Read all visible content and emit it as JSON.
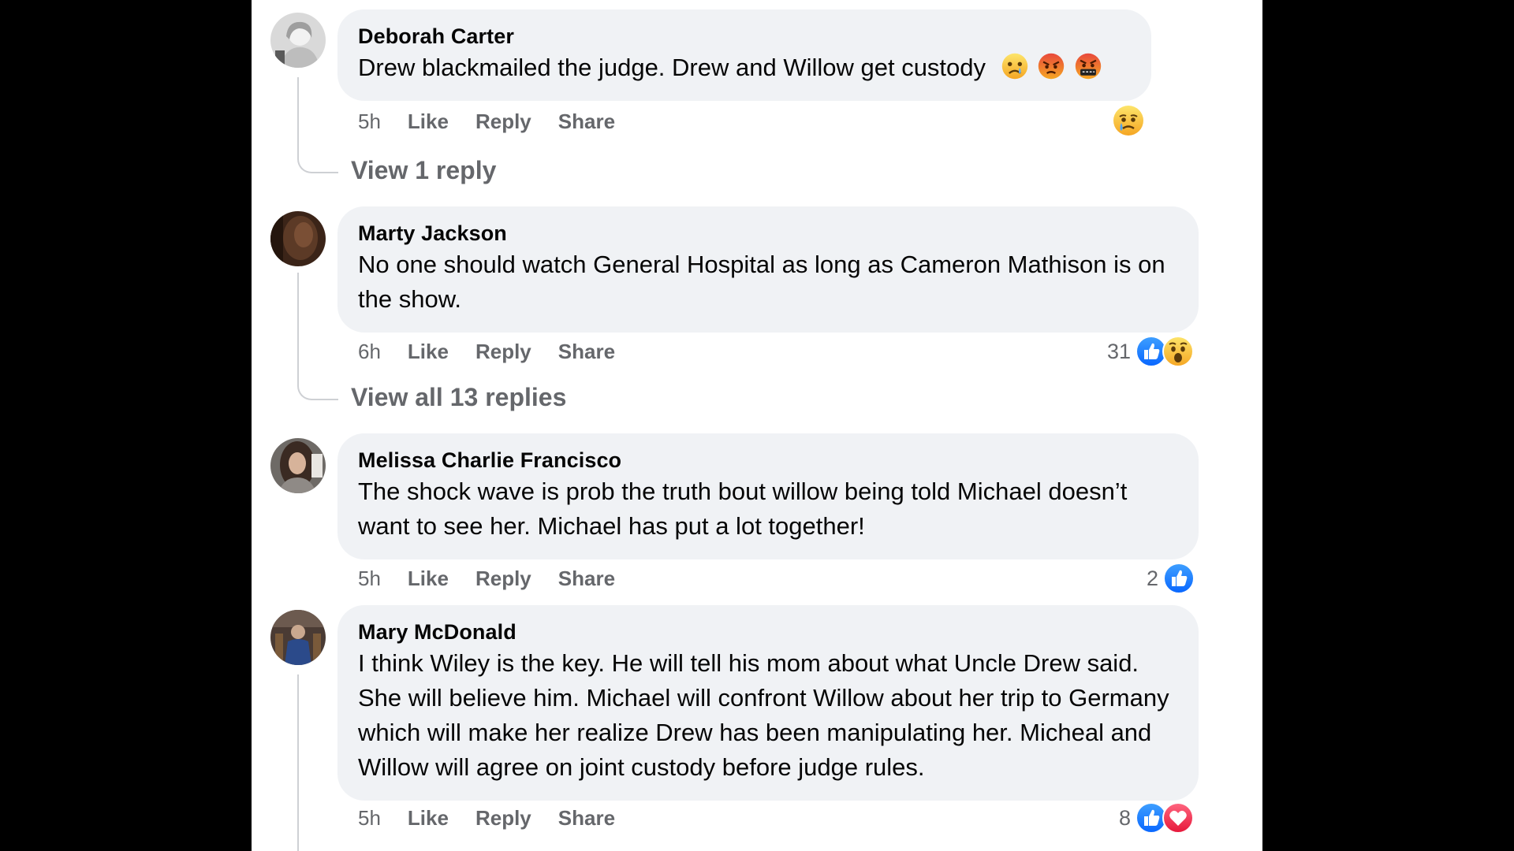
{
  "comments": [
    {
      "author": "Deborah Carter",
      "text": "Drew blackmailed the judge. Drew and Willow get custody",
      "text_emojis": [
        "sad-emoji",
        "angry-emoji",
        "cursing-emoji"
      ],
      "time": "5h",
      "like_label": "Like",
      "reply_label": "Reply",
      "share_label": "Share",
      "reaction_count": "",
      "reactions": [
        "sad-reaction"
      ],
      "view_replies": "View 1 reply"
    },
    {
      "author": "Marty Jackson",
      "text": "No one should watch General Hospital as long as Cameron Mathison is on the show.",
      "time": "6h",
      "like_label": "Like",
      "reply_label": "Reply",
      "share_label": "Share",
      "reaction_count": "31",
      "reactions": [
        "like-reaction",
        "wow-reaction"
      ],
      "view_replies": "View all 13 replies"
    },
    {
      "author": "Melissa Charlie Francisco",
      "text": "The shock wave is prob the truth bout willow being told Michael doesn’t want to see her. Michael has put a lot together!",
      "time": "5h",
      "like_label": "Like",
      "reply_label": "Reply",
      "share_label": "Share",
      "reaction_count": "2",
      "reactions": [
        "like-reaction"
      ]
    },
    {
      "author": "Mary McDonald",
      "text": "I think Wiley is the key. He will tell his mom about what Uncle Drew said. She will believe him. Michael will confront Willow about her trip to Germany which will make her realize Drew has been manipulating her. Micheal and Willow will agree on joint custody before judge rules.",
      "time": "5h",
      "like_label": "Like",
      "reply_label": "Reply",
      "share_label": "Share",
      "reaction_count": "8",
      "reactions": [
        "like-reaction",
        "love-reaction"
      ]
    }
  ],
  "colors": {
    "page_bg": "#000000",
    "panel_bg": "#ffffff",
    "bubble_bg": "#f0f2f5",
    "muted_text": "#65676b",
    "main_text": "#050505",
    "like_blue": "#1877f2",
    "love_red": "#f33e58",
    "emoji_yellow": "#f7b928"
  }
}
